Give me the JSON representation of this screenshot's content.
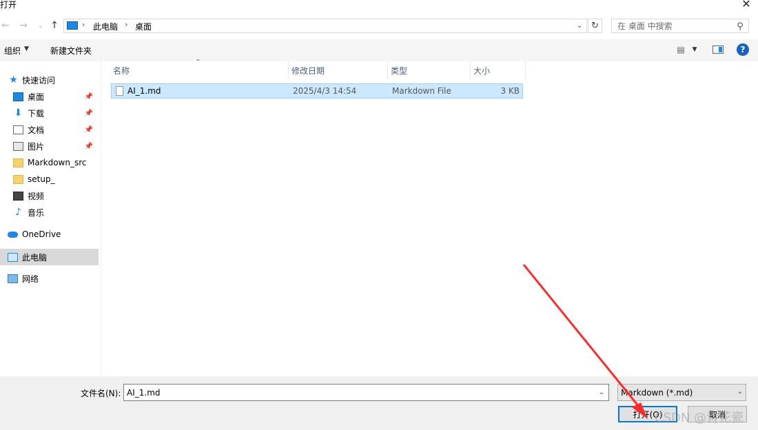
{
  "window": {
    "title": "打开",
    "close_glyph": "✕"
  },
  "nav": {
    "back_glyph": "←",
    "forward_glyph": "→",
    "recent_glyph": "⌄",
    "up_glyph": "↑",
    "breadcrumb": [
      "此电脑",
      "桌面"
    ],
    "breadcrumb_sep": "›",
    "address_dropdown_glyph": "⌄",
    "refresh_glyph": "↻",
    "search_placeholder": "在 桌面 中搜索",
    "search_glyph": "⚲"
  },
  "toolbar": {
    "organize_label": "组织",
    "organize_caret": "▼",
    "new_folder_label": "新建文件夹",
    "view_glyph": "▤",
    "view_caret": "▼",
    "help_glyph": "?"
  },
  "sidebar": {
    "quick_access": "快速访问",
    "pin_glyph": "📌",
    "items": [
      {
        "label": "桌面",
        "icon": "desktop-icon",
        "pinned": true
      },
      {
        "label": "下载",
        "icon": "download-icon",
        "pinned": true
      },
      {
        "label": "文档",
        "icon": "document-icon",
        "pinned": true
      },
      {
        "label": "图片",
        "icon": "pictures-icon",
        "pinned": true
      },
      {
        "label": "Markdown_src",
        "icon": "folder-icon",
        "pinned": false
      },
      {
        "label": "setup_",
        "icon": "folder-icon",
        "pinned": false
      },
      {
        "label": "视频",
        "icon": "video-icon",
        "pinned": false
      },
      {
        "label": "音乐",
        "icon": "music-icon",
        "pinned": false
      }
    ],
    "onedrive": "OneDrive",
    "this_pc": "此电脑",
    "network": "网络",
    "star_glyph": "★",
    "music_glyph": "♪",
    "download_glyph": "⬇"
  },
  "file_list": {
    "sort_glyph": "⌃",
    "columns": [
      "名称",
      "修改日期",
      "类型",
      "大小"
    ],
    "rows": [
      {
        "name": "AI_1.md",
        "modified": "2025/4/3 14:54",
        "type": "Markdown File",
        "size": "3 KB"
      }
    ]
  },
  "footer": {
    "filename_label": "文件名(N):",
    "filename_value": "AI_1.md",
    "filename_dd_glyph": "⌄",
    "filter_value": "Markdown (*.md)",
    "filter_dd_glyph": "⌄",
    "open_label": "打开(O)",
    "cancel_label": "取消"
  },
  "watermark": "CSDN @青花瓷",
  "colors": {
    "accent": "#0078d7",
    "selection": "#cce8ff",
    "annotation_arrow": "#ff2a2a"
  }
}
